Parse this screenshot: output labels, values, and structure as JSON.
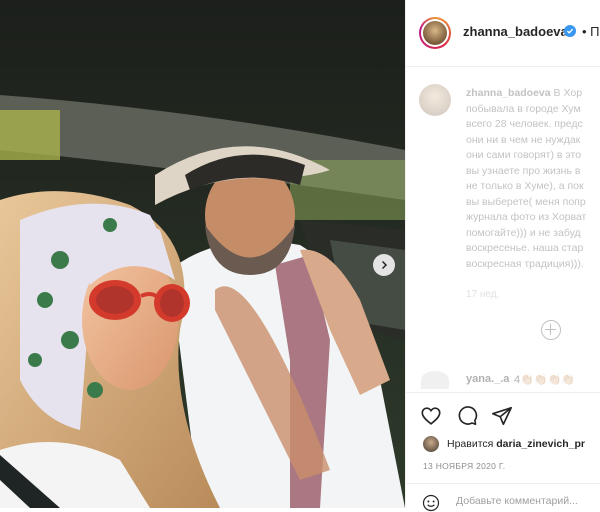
{
  "post": {
    "username": "zhanna_badoeva",
    "follow_label": "• По",
    "caption_username": "zhanna_badoeva",
    "caption_lines": [
      "В Хор",
      "побывала в городе Хум",
      "всего 28 человек. предс",
      "они ни в чем не нуждак",
      "они сами говорят) в это",
      "вы узнаете про жизнь в",
      "не только в Хуме), а пок",
      "вы выберете( меня попр",
      "журнала фото из Хорват",
      "помогайте))) и не забуд",
      "воскресенье. наша стар",
      "воскресная традиция)))."
    ],
    "caption_time": "17 нед.",
    "comment_user": "yana._.a",
    "comment_text": "4👏🏼👏🏼👏🏼👏🏼",
    "likes_prefix": "Нравится",
    "likes_user": "daria_zinevich_pr",
    "date": "13 НОЯБРЯ 2020 Г.",
    "add_comment_placeholder": "Добавьте комментарий..."
  },
  "colors": {
    "verified": "#3897f0",
    "text": "#262626",
    "muted": "#8e8e8e"
  },
  "icons": [
    "chevron-right-icon",
    "verified-badge-icon",
    "heart-icon",
    "comment-icon",
    "share-icon",
    "plus-circle-icon",
    "emoji-icon"
  ]
}
